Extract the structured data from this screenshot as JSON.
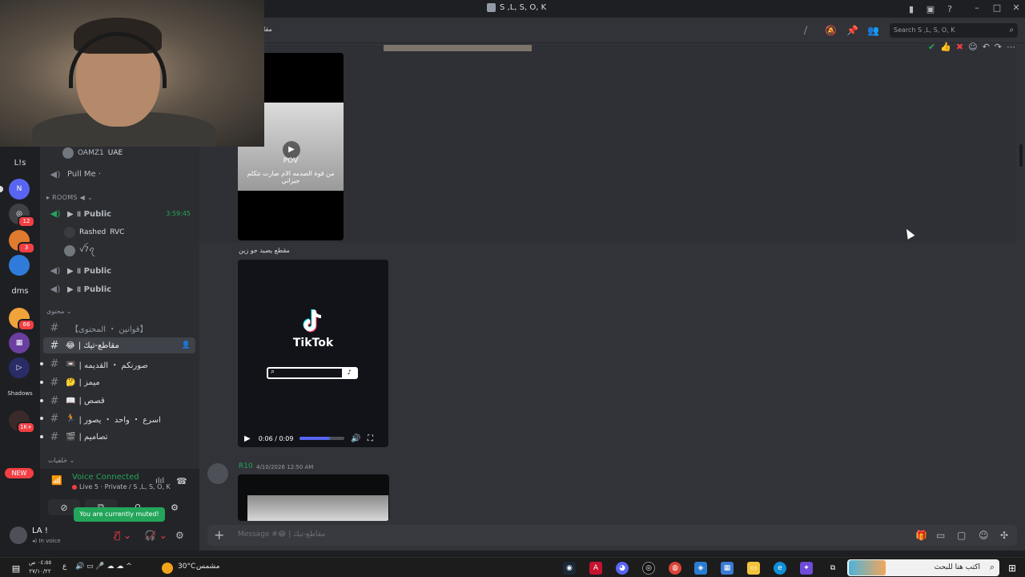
{
  "titlebar": {
    "title": "S ,L, S, O, K",
    "icons": [
      "inbox-icon",
      "screen-icon",
      "help-icon"
    ],
    "window_controls": [
      "minimize",
      "maximize",
      "close"
    ]
  },
  "rail": {
    "servers": [
      {
        "label": "L!s",
        "text": true
      },
      {
        "label": "",
        "color": "#5865f2",
        "icon": "bot-icon"
      },
      {
        "label": "",
        "color": "#3f4147",
        "badge": "12"
      },
      {
        "label": "",
        "color": "#e07a2f",
        "badge": "3"
      },
      {
        "label": "",
        "color": "#2f7bd9"
      },
      {
        "label": "dms",
        "text": true
      },
      {
        "label": "",
        "color": "#f0a33a",
        "badge": "66"
      },
      {
        "label": "",
        "color": "#6b3fa0"
      },
      {
        "label": "",
        "color": "#2a2c66"
      },
      {
        "label": "Shadows",
        "text": true
      },
      {
        "label": "",
        "color": "#3a2a2a",
        "badge": "1K+"
      }
    ],
    "new_badge": "NEW"
  },
  "sidebar": {
    "top_member": {
      "name": "OAMZ1",
      "tag": "UAE"
    },
    "pull_me": "Pull Me ·",
    "rooms_category": "ROOMS ◀",
    "voice_channels": [
      {
        "name": "Public",
        "time": "3:59:45",
        "active": true
      },
      {
        "name": "Public"
      },
      {
        "name": "Public"
      }
    ],
    "members": [
      {
        "name": "Rashed",
        "tag": "RVC"
      },
      {
        "name": "ꪜ7ꪖ"
      }
    ],
    "content_category": "محتوى",
    "text_channels": [
      {
        "name": "【قوانين ・ المحتوى】",
        "emoji": ""
      },
      {
        "name": "مقاطع-تيك",
        "emoji": "😂",
        "active": true
      },
      {
        "name": "صورنكم ・ القديمه",
        "emoji": "📼"
      },
      {
        "name": "ميمز",
        "emoji": "🤔"
      },
      {
        "name": "قصص",
        "emoji": "📖"
      },
      {
        "name": "اسرع ・ واحد ・ يصور",
        "emoji": "🏃"
      },
      {
        "name": "تصاميم",
        "emoji": "🎬"
      }
    ],
    "last_category": "خلفيات"
  },
  "voice_panel": {
    "title": "Voice Connected",
    "subtitle": "Live 5 · Private / S ,L, S, O, K",
    "tooltip": "You are currently muted!"
  },
  "user": {
    "name": "LA !",
    "status": "In voice"
  },
  "main": {
    "header_partial": "مقا",
    "search_placeholder": "Search S ,L, S, O, K",
    "video1": {
      "cap1": "POV",
      "cap2": "من قوة الصدمه الام صارت تتكلم جيزاني"
    },
    "caption": "مقطع يصيد جو زين",
    "video2": {
      "brand": "TikTok",
      "time": "0:06 / 0:09",
      "progress": 0.67
    },
    "message": {
      "author": "R10",
      "timestamp": "4/10/2026 12:50 AM"
    },
    "composer_placeholder": "Message #😂 | مقاطع-تيك"
  },
  "taskbar": {
    "clock_time": "٠٤:٥٥ ص",
    "clock_date": "٢٧/١٠/٢٢",
    "lang": "ع",
    "weather": "30°C",
    "weather_label": "مشمس",
    "search_text": "اكتب هنا للبحث"
  }
}
